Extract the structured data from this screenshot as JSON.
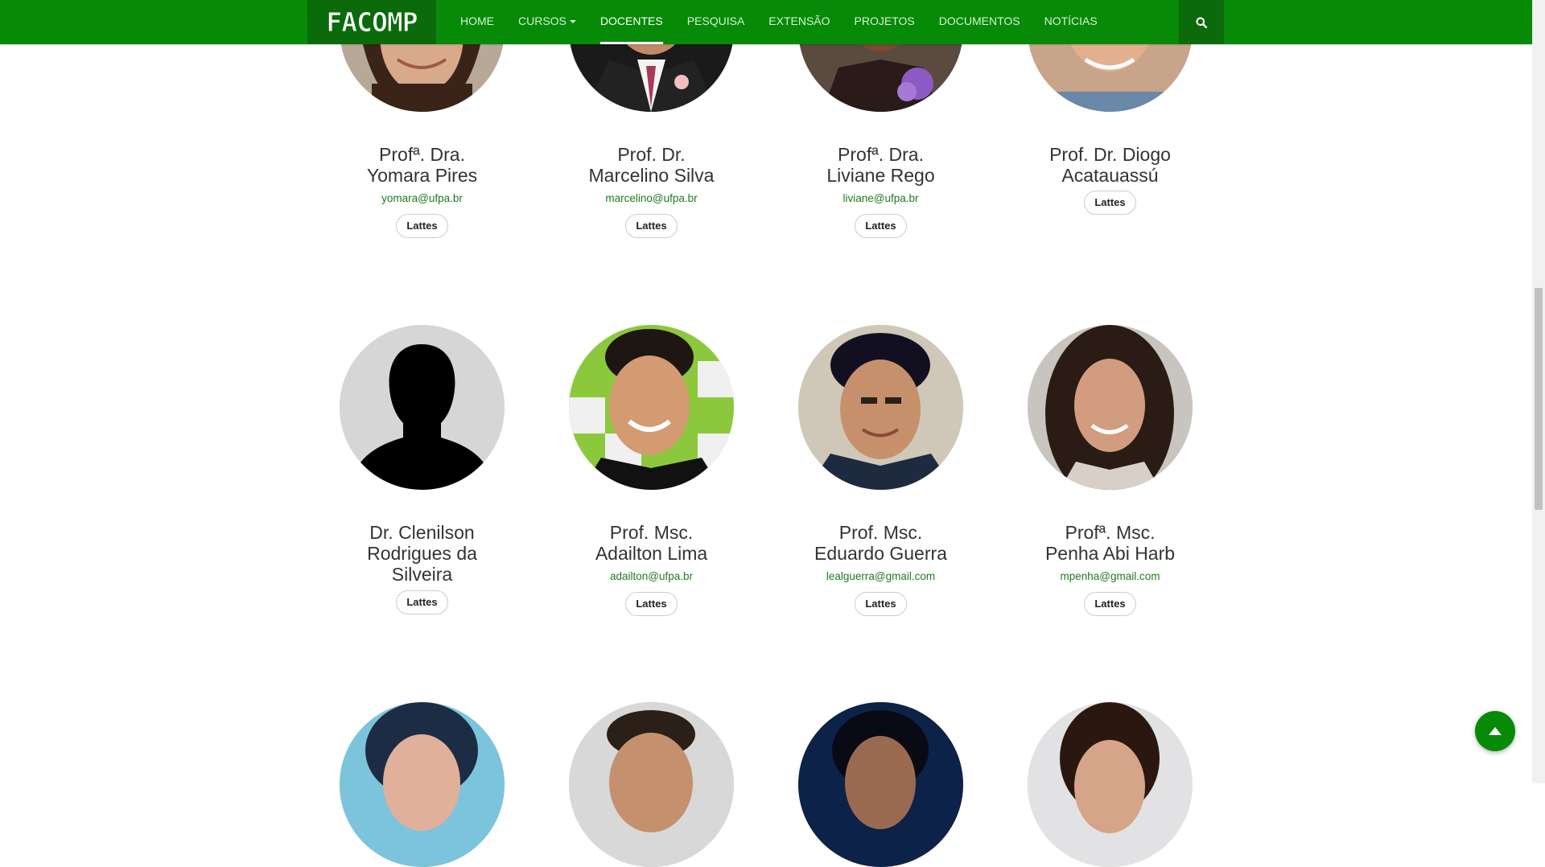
{
  "brand": {
    "logo_text": "FACOMP"
  },
  "nav": {
    "items": [
      {
        "label": "HOME"
      },
      {
        "label": "CURSOS",
        "dropdown": true
      },
      {
        "label": "DOCENTES",
        "active": true
      },
      {
        "label": "PESQUISA"
      },
      {
        "label": "EXTENSÃO"
      },
      {
        "label": "PROJETOS"
      },
      {
        "label": "DOCUMENTOS"
      },
      {
        "label": "NOTÍCIAS"
      }
    ]
  },
  "colors": {
    "primary": "#068a07",
    "primary_dark": "#0b6b0b",
    "email": "#1f7a1f"
  },
  "icons": {
    "search": "search-icon",
    "to_top": "arrow-up-icon"
  },
  "faculty": [
    {
      "name_line1": "Profª. Dra.",
      "name_line2": "Yomara Pires",
      "email": "yomara@ufpa.br",
      "button": "Lattes",
      "photo": "woman-dark-hair"
    },
    {
      "name_line1": "Prof. Dr.",
      "name_line2": "Marcelino Silva",
      "email": "marcelino@ufpa.br",
      "button": "Lattes",
      "photo": "man-suit"
    },
    {
      "name_line1": "Profª. Dra.",
      "name_line2": "Liviane Rego",
      "email": "liviane@ufpa.br",
      "button": "Lattes",
      "photo": "woman-purple-flower"
    },
    {
      "name_line1": "Prof. Dr. Diogo",
      "name_line2": "Acatauassú",
      "email": "",
      "button": "Lattes",
      "photo": "man-smiling"
    },
    {
      "name_line1": "Dr. Clenilson",
      "name_line2": "Rodrigues da",
      "name_line3": "Silveira",
      "email": "",
      "button": "Lattes",
      "photo": "silhouette"
    },
    {
      "name_line1": "Prof. Msc.",
      "name_line2": "Adailton Lima",
      "email": "adailton@ufpa.br",
      "button": "Lattes",
      "photo": "man-green-bg"
    },
    {
      "name_line1": "Prof. Msc.",
      "name_line2": "Eduardo Guerra",
      "email": "lealguerra@gmail.com",
      "button": "Lattes",
      "photo": "man-sweater"
    },
    {
      "name_line1": "Profª. Msc.",
      "name_line2": "Penha Abi Harb",
      "email": "mpenha@gmail.com",
      "button": "Lattes",
      "photo": "woman-curly-hair"
    }
  ],
  "partial_row": [
    {
      "photo": "woman-blue-bg"
    },
    {
      "photo": "man-short-hair"
    },
    {
      "photo": "woman-dark-bg"
    },
    {
      "photo": "woman-light-bg"
    }
  ]
}
